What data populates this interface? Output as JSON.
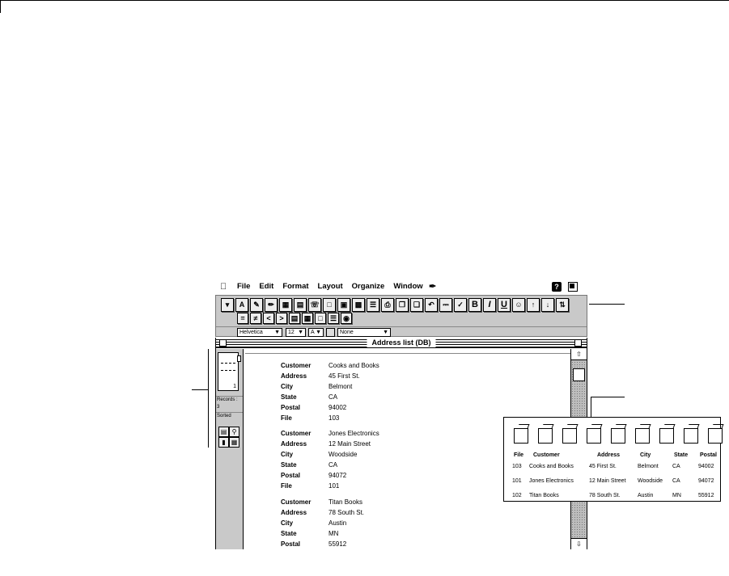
{
  "menubar": {
    "apple": "",
    "items": [
      "File",
      "Edit",
      "Format",
      "Layout",
      "Organize",
      "Window"
    ],
    "help_label": "?"
  },
  "toolbar": {
    "font_name": "Helvetica",
    "font_size": "12",
    "text_color": "A",
    "style_option": "None",
    "style_buttons": {
      "bold": "B",
      "italic": "I",
      "underline": "U"
    },
    "nav_buttons": [
      "=",
      "≠",
      "<",
      ">"
    ]
  },
  "window": {
    "title": "Address list (DB)"
  },
  "leftpanel": {
    "page_number": "1",
    "records_label": "Records :",
    "records_count": "3",
    "sorted_label": "Sorted"
  },
  "records": [
    {
      "fields": [
        {
          "label": "Customer",
          "value": "Cooks and Books"
        },
        {
          "label": "Address",
          "value": "45 First St."
        },
        {
          "label": "City",
          "value": "Belmont"
        },
        {
          "label": "State",
          "value": "CA"
        },
        {
          "label": "Postal",
          "value": "94002"
        },
        {
          "label": "File",
          "value": "103"
        }
      ]
    },
    {
      "fields": [
        {
          "label": "Customer",
          "value": "Jones Electronics"
        },
        {
          "label": "Address",
          "value": "12 Main Street"
        },
        {
          "label": "City",
          "value": "Woodside"
        },
        {
          "label": "State",
          "value": "CA"
        },
        {
          "label": "Postal",
          "value": "94072"
        },
        {
          "label": "File",
          "value": "101"
        }
      ]
    },
    {
      "fields": [
        {
          "label": "Customer",
          "value": "Titan Books"
        },
        {
          "label": "Address",
          "value": "78 South St."
        },
        {
          "label": "City",
          "value": "Austin"
        },
        {
          "label": "State",
          "value": "MN"
        },
        {
          "label": "Postal",
          "value": "55912"
        }
      ]
    }
  ],
  "list_view": {
    "headers": [
      "File",
      "Customer",
      "Address",
      "City",
      "State",
      "Postal"
    ],
    "rows": [
      [
        "103",
        "Cooks and Books",
        "45 First St.",
        "Belmont",
        "CA",
        "94002"
      ],
      [
        "101",
        "Jones Electronics",
        "12 Main Street",
        "Woodside",
        "CA",
        "94072"
      ],
      [
        "102",
        "Titan Books",
        "78 South St.",
        "Austin",
        "MN",
        "55912"
      ]
    ],
    "icon_count": 9
  }
}
